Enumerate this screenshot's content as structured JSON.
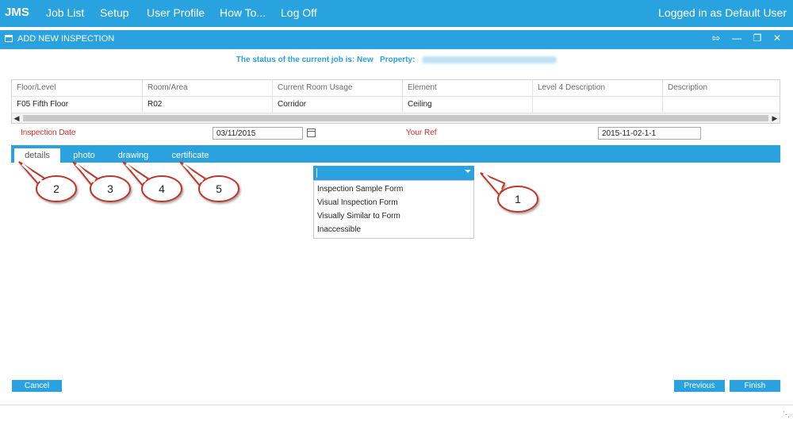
{
  "topnav": {
    "brand": "JMS",
    "items": [
      "Job List",
      "Setup",
      "User Profile",
      "How To...",
      "Log Off"
    ],
    "login_status": "Logged in as Default User"
  },
  "window": {
    "title": "ADD NEW INSPECTION",
    "controls": [
      "pin-icon",
      "minimize-icon",
      "maximize-icon",
      "close-icon"
    ]
  },
  "status": {
    "prefix": "The status of the current job is: New",
    "property_label": "Property:"
  },
  "grid": {
    "headers": [
      "Floor/Level",
      "Room/Area",
      "Current Room Usage",
      "Element",
      "Level 4 Description",
      "Description"
    ],
    "row": [
      "F05 Fifth Floor",
      "R02",
      "Corridor",
      "Ceiling",
      "",
      ""
    ]
  },
  "form": {
    "inspection_date_label": "Inspection Date",
    "inspection_date_value": "03/11/2015",
    "your_ref_label": "Your Ref",
    "your_ref_value": "2015-11-02-1-1"
  },
  "tabs": [
    {
      "label": "details",
      "active": true
    },
    {
      "label": "photo",
      "active": false
    },
    {
      "label": "drawing",
      "active": false
    },
    {
      "label": "certificate",
      "active": false
    }
  ],
  "dropdown": {
    "value": "",
    "options": [
      "Inspection Sample Form",
      "Visual Inspection Form",
      "Visually Similar to Form",
      "Inaccessible"
    ]
  },
  "callouts": [
    "1",
    "2",
    "3",
    "4",
    "5"
  ],
  "buttons": {
    "cancel": "Cancel",
    "previous": "Previous",
    "finish": "Finish"
  },
  "colors": {
    "accent": "#2aa2df",
    "label_red": "#d12b2b",
    "callout_stroke": "#c0392b"
  }
}
